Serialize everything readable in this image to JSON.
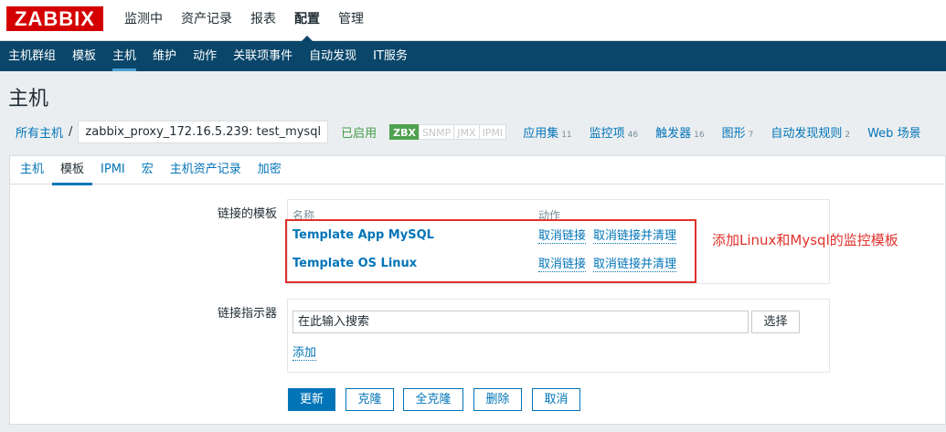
{
  "header": {
    "logo_text": "ZABBIX",
    "menu": [
      {
        "label": "监测中"
      },
      {
        "label": "资产记录"
      },
      {
        "label": "报表"
      },
      {
        "label": "配置"
      },
      {
        "label": "管理"
      }
    ]
  },
  "submenu": [
    {
      "label": "主机群组"
    },
    {
      "label": "模板"
    },
    {
      "label": "主机"
    },
    {
      "label": "维护"
    },
    {
      "label": "动作"
    },
    {
      "label": "关联项事件"
    },
    {
      "label": "自动发现"
    },
    {
      "label": "IT服务"
    }
  ],
  "page_title": "主机",
  "hostbar": {
    "all_hosts": "所有主机",
    "separator": "/",
    "host_name": "zabbix_proxy_172.16.5.239: test_mysql",
    "status": "已启用",
    "availability": [
      "ZBX",
      "SNMP",
      "JMX",
      "IPMI"
    ],
    "stats": [
      {
        "label": "应用集",
        "count": "11"
      },
      {
        "label": "监控项",
        "count": "46"
      },
      {
        "label": "触发器",
        "count": "16"
      },
      {
        "label": "图形",
        "count": "7"
      },
      {
        "label": "自动发现规则",
        "count": "2"
      },
      {
        "label": "Web 场景",
        "count": ""
      }
    ]
  },
  "tabs": [
    {
      "label": "主机"
    },
    {
      "label": "模板"
    },
    {
      "label": "IPMI"
    },
    {
      "label": "宏"
    },
    {
      "label": "主机资产记录"
    },
    {
      "label": "加密"
    }
  ],
  "linked_templates": {
    "label": "链接的模板",
    "col_name": "名称",
    "col_action": "动作",
    "rows": [
      {
        "name": "Template App MySQL",
        "unlink": "取消链接",
        "unlink_clear": "取消链接并清理"
      },
      {
        "name": "Template OS Linux",
        "unlink": "取消链接",
        "unlink_clear": "取消链接并清理"
      }
    ]
  },
  "link_indicator": {
    "label": "链接指示器",
    "search_placeholder": "在此输入搜索",
    "select_button": "选择",
    "add_link": "添加"
  },
  "buttons": {
    "update": "更新",
    "clone": "克隆",
    "full_clone": "全克隆",
    "delete": "删除",
    "cancel": "取消"
  },
  "annotation": {
    "text": "添加Linux和Mysql的监控模板",
    "color": "#e0312b"
  }
}
